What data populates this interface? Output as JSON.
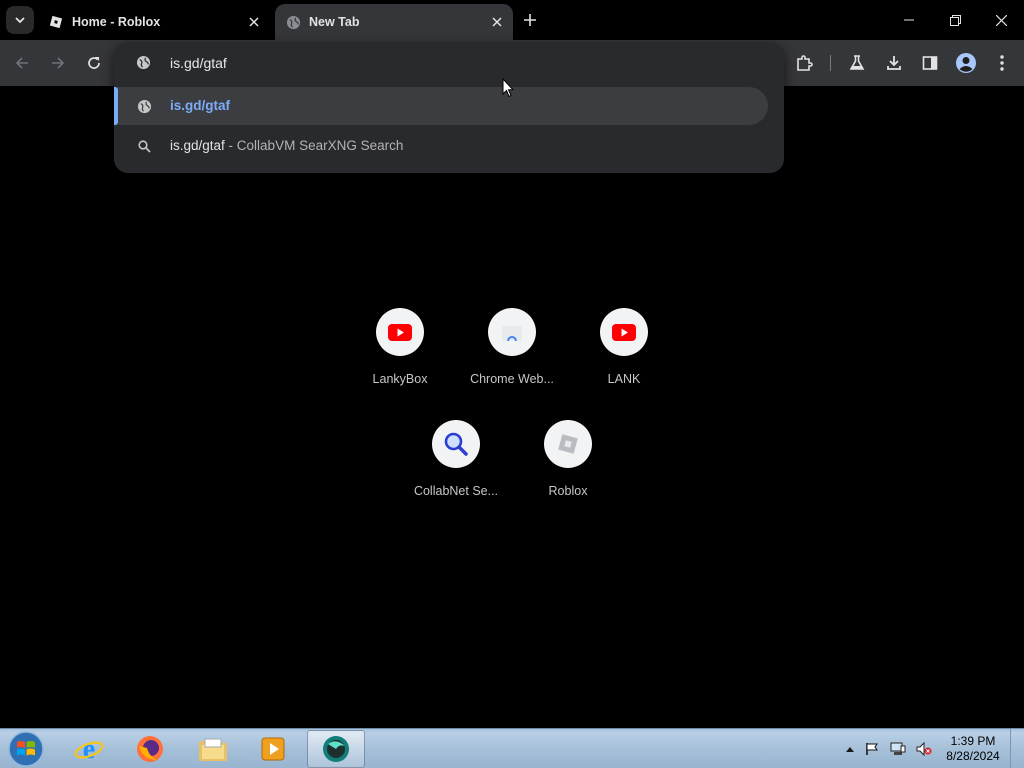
{
  "tabs": [
    {
      "title": "Home - Roblox",
      "favicon": "roblox-icon"
    },
    {
      "title": "New Tab",
      "favicon": "globe-icon",
      "active": true
    }
  ],
  "omnibox": {
    "input_value": "is.gd/gtaf",
    "suggestions": [
      {
        "icon": "globe-icon",
        "text": "is.gd/gtaf"
      },
      {
        "icon": "search-icon",
        "text": "is.gd/gtaf",
        "description": " - CollabVM SearXNG Search"
      }
    ]
  },
  "shortcuts": [
    {
      "label": "LankyBox",
      "icon": "youtube-icon"
    },
    {
      "label": "Chrome Web...",
      "icon": "chrome-web-store-icon"
    },
    {
      "label": "LANK",
      "icon": "youtube-icon"
    },
    {
      "label": "CollabNet Se...",
      "icon": "magnifier-icon"
    },
    {
      "label": "Roblox",
      "icon": "roblox-icon"
    }
  ],
  "taskbar": {
    "apps": [
      "internet-explorer-icon",
      "firefox-icon",
      "file-explorer-icon",
      "media-player-icon",
      "browser-icon"
    ],
    "clock_time": "1:39 PM",
    "clock_date": "8/28/2024"
  },
  "colors": {
    "accent": "#7cacf8",
    "youtube_red": "#ff0000",
    "toolbar_bg": "#35363a"
  }
}
